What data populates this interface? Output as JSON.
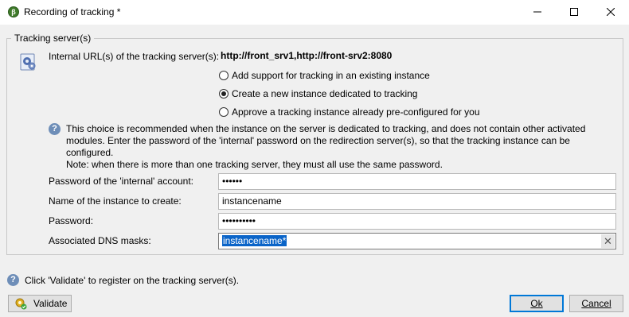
{
  "window": {
    "title": "Recording of tracking *",
    "app_icon_glyph": "β",
    "controls": {
      "minimize_icon": "minimize-icon",
      "maximize_icon": "maximize-icon",
      "close_icon": "close-icon"
    }
  },
  "group": {
    "label": "Tracking server(s)",
    "icon": "server-settings-icon",
    "urls_label": "Internal URL(s) of the tracking server(s):",
    "urls_value": "http://front_srv1,http://front-srv2:8080"
  },
  "options": [
    {
      "label": "Add support for tracking in an existing instance",
      "checked": false
    },
    {
      "label": "Create a new instance dedicated to tracking",
      "checked": true
    },
    {
      "label": "Approve a tracking instance already pre-configured for you",
      "checked": false
    }
  ],
  "note": {
    "icon": "help-icon",
    "lines": [
      "This choice is recommended when the instance on the server is dedicated to tracking, and does not contain other activated",
      "modules. Enter the password of the 'internal' password on the redirection server(s), so that the tracking instance can be configured.",
      "Note: when there is more than one tracking server, they must all use the same password."
    ]
  },
  "form": {
    "internal_password_label": "Password of the 'internal' account:",
    "internal_password_value": "••••••",
    "instance_name_label": "Name of the instance to create:",
    "instance_name_value": "instancename",
    "password_label": "Password:",
    "password_value": "••••••••••",
    "dns_masks_label": "Associated DNS masks:",
    "dns_masks_value": "instancename*",
    "clear_glyph": "✕"
  },
  "footer": {
    "hint_icon": "help-icon",
    "hint_text": "Click 'Validate' to register on the tracking server(s).",
    "validate_label": "Validate",
    "validate_icon": "gear-check-icon",
    "ok_label": "Ok",
    "cancel_label": "Cancel"
  },
  "colors": {
    "selection": "#0a64c8",
    "default_button_border": "#0078d7",
    "help_icon": "#6e8eb8"
  }
}
